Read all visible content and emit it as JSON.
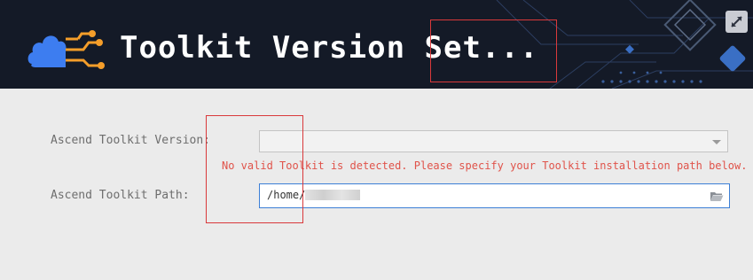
{
  "header": {
    "title": "Toolkit Version Set...",
    "logo_icon": "ascend-logo-icon",
    "expand_icon": "expand-arrows-icon"
  },
  "form": {
    "version": {
      "label": "Ascend Toolkit Version:",
      "value": ""
    },
    "error_message": "No valid Toolkit is detected. Please specify your Toolkit installation path below.",
    "path": {
      "label": "Ascend Toolkit Path:",
      "value": "/home/",
      "browse_icon": "folder-open-icon"
    }
  },
  "colors": {
    "header_background": "#141a27",
    "accent_blue": "#3c7fd6",
    "error_red": "#e0534a",
    "logo_blue": "#3d7df0",
    "logo_orange": "#f59e2a",
    "annotation_red": "#d9393b"
  }
}
